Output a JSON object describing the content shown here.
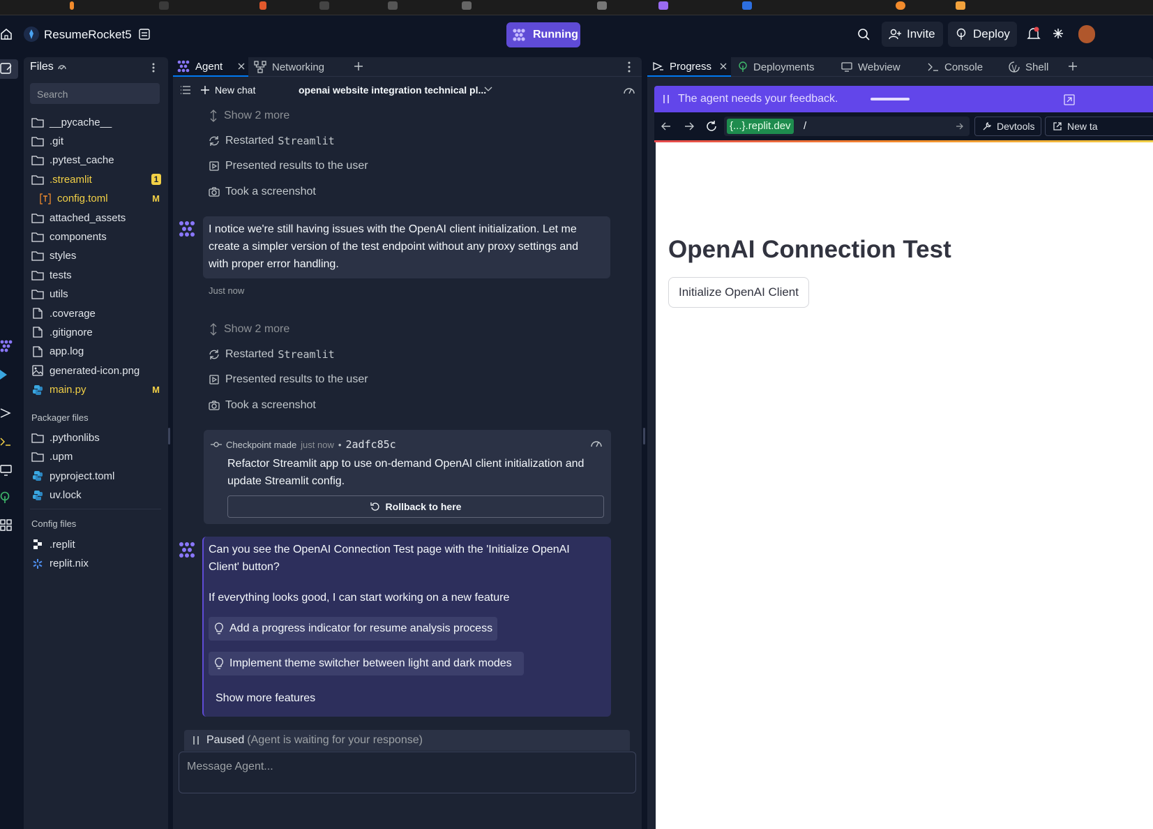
{
  "app": {
    "project_name": "ResumeRocket5",
    "run_status": "Running",
    "invite_label": "Invite",
    "deploy_label": "Deploy"
  },
  "files_panel": {
    "title": "Files",
    "search_placeholder": "Search",
    "items": [
      {
        "name": "__pycache__",
        "type": "folder"
      },
      {
        "name": ".git",
        "type": "folder"
      },
      {
        "name": ".pytest_cache",
        "type": "folder"
      },
      {
        "name": ".streamlit",
        "type": "folder",
        "badge": "1"
      },
      {
        "name": "config.toml",
        "type": "toml",
        "badge": "M"
      },
      {
        "name": "attached_assets",
        "type": "folder"
      },
      {
        "name": "components",
        "type": "folder"
      },
      {
        "name": "styles",
        "type": "folder"
      },
      {
        "name": "tests",
        "type": "folder"
      },
      {
        "name": "utils",
        "type": "folder"
      },
      {
        "name": ".coverage",
        "type": "file"
      },
      {
        "name": ".gitignore",
        "type": "file"
      },
      {
        "name": "app.log",
        "type": "file"
      },
      {
        "name": "generated-icon.png",
        "type": "image"
      },
      {
        "name": "main.py",
        "type": "python",
        "badge": "M"
      }
    ],
    "packager_label": "Packager files",
    "packager_items": [
      {
        "name": ".pythonlibs",
        "type": "folder"
      },
      {
        "name": ".upm",
        "type": "folder"
      },
      {
        "name": "pyproject.toml",
        "type": "python"
      },
      {
        "name": "uv.lock",
        "type": "python"
      }
    ],
    "config_label": "Config files",
    "config_items": [
      {
        "name": ".replit",
        "type": "replit"
      },
      {
        "name": "replit.nix",
        "type": "nix"
      }
    ]
  },
  "agent_panel": {
    "tabs": [
      {
        "label": "Agent",
        "icon": "agent-icon",
        "active": true
      },
      {
        "label": "Networking",
        "icon": "network-icon"
      }
    ],
    "new_chat_label": "New chat",
    "chat_title": "openai website integration technical pl...",
    "group1": {
      "show_more": "Show 2 more",
      "restarted_prefix": "Restarted",
      "restarted_target": "Streamlit",
      "presented": "Presented results to the user",
      "screenshot": "Took a screenshot"
    },
    "message1": {
      "text": "I notice we're still having issues with the OpenAI client initialization. Let me create a simpler version of the test endpoint without any proxy settings and with proper error handling.",
      "time": "Just now"
    },
    "group2": {
      "show_more": "Show 2 more",
      "restarted_prefix": "Restarted",
      "restarted_target": "Streamlit",
      "presented": "Presented results to the user",
      "screenshot": "Took a screenshot"
    },
    "checkpoint": {
      "label": "Checkpoint made",
      "time": "just now",
      "hash": "2adfc85c",
      "description": "Refactor Streamlit app to use on-demand OpenAI client initialization and update Streamlit config.",
      "rollback_label": "Rollback to here"
    },
    "message2": {
      "question": "Can you see the OpenAI Connection Test page with the 'Initialize OpenAI Client' button?",
      "followup": "If everything looks good, I can start working on a new feature",
      "suggestions": [
        "Add a progress indicator for resume analysis process",
        "Implement theme switcher between light and dark modes"
      ],
      "show_more_features": "Show more features"
    },
    "paused_label": "Paused",
    "paused_detail": "(Agent is waiting for your response)",
    "input_placeholder": "Message Agent..."
  },
  "right_panel": {
    "tabs": [
      {
        "label": "Progress",
        "icon": "progress-icon",
        "active": true
      },
      {
        "label": "Deployments",
        "icon": "deploy-icon"
      },
      {
        "label": "Webview",
        "icon": "monitor-icon"
      },
      {
        "label": "Console",
        "icon": "console-icon"
      },
      {
        "label": "Shell",
        "icon": "shell-icon"
      }
    ],
    "feedback_banner": "The agent needs your feedback.",
    "url_host": "{...}.replit.dev",
    "url_path": "/",
    "devtools_label": "Devtools",
    "new_tab_label": "New ta",
    "page_heading": "OpenAI Connection Test",
    "page_button": "Initialize OpenAI Client"
  },
  "colors": {
    "accent_purple": "#5f4bd6",
    "banner_purple": "#6246ea",
    "modified_yellow": "#f2d046",
    "toml_orange": "#f28b2c",
    "python_blue": "#3aa7e0",
    "url_green": "#1e8c4e"
  }
}
